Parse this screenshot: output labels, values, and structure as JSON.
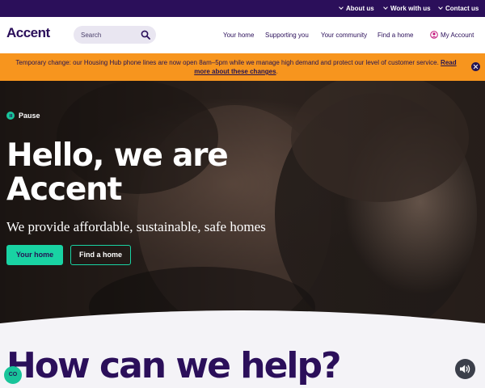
{
  "utility_nav": {
    "items": [
      {
        "label": "About us"
      },
      {
        "label": "Work with us"
      },
      {
        "label": "Contact us"
      }
    ]
  },
  "header": {
    "logo": "Accent",
    "search": {
      "placeholder": "Search",
      "icon": "search-icon"
    },
    "nav": [
      {
        "label": "Your home"
      },
      {
        "label": "Supporting you"
      },
      {
        "label": "Your community"
      },
      {
        "label": "Find a home"
      }
    ],
    "account": {
      "label": "My Account",
      "icon": "user-icon"
    }
  },
  "alert": {
    "text": "Temporary change: our Housing Hub phone lines are now open 8am–5pm while we manage high demand and protect our level of customer service.",
    "link": "Read more about these changes",
    "suffix": ".",
    "background": "#f7951e"
  },
  "hero": {
    "pause_label": "Pause",
    "title": "Hello, we are Accent",
    "subtitle": "We provide affordable, sustainable, safe homes",
    "primary_button": "Your home",
    "secondary_button": "Find a home",
    "accent_color": "#19d3a3"
  },
  "help": {
    "heading": "How can we help?"
  },
  "floating": {
    "cookie_label": "CO",
    "audio_icon": "speaker-icon"
  },
  "colors": {
    "brand_dark": "#2b0f5a",
    "accent_green": "#19d3a3",
    "alert_orange": "#f7951e"
  }
}
